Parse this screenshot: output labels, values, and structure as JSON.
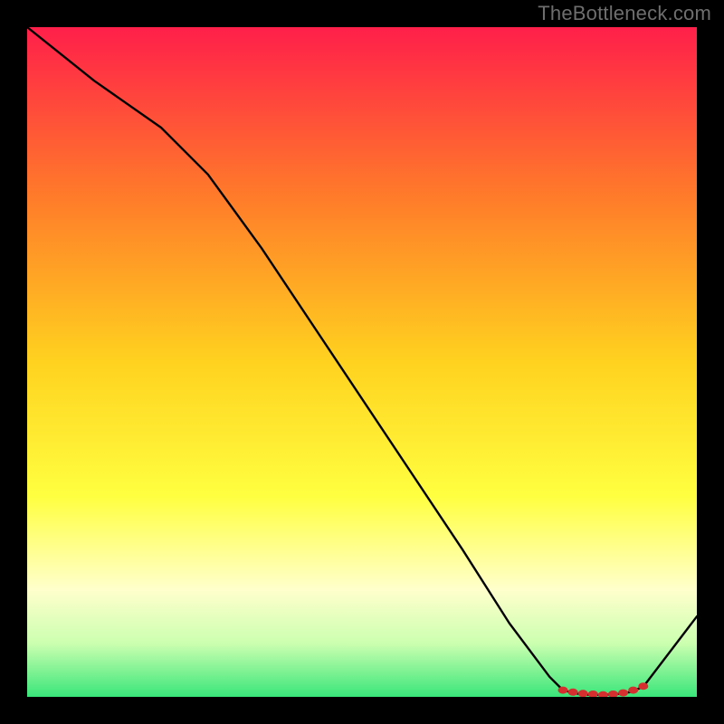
{
  "watermark": "TheBottleneck.com",
  "colors": {
    "curve": "#000000",
    "marker": "#d62f2f",
    "gradient_stops": [
      {
        "offset": "0%",
        "color": "#ff1f4a"
      },
      {
        "offset": "25%",
        "color": "#ff7a2a"
      },
      {
        "offset": "50%",
        "color": "#ffd21f"
      },
      {
        "offset": "70%",
        "color": "#ffff40"
      },
      {
        "offset": "84%",
        "color": "#ffffcc"
      },
      {
        "offset": "92%",
        "color": "#ccffb0"
      },
      {
        "offset": "100%",
        "color": "#39e67a"
      }
    ]
  },
  "chart_data": {
    "type": "line",
    "title": "",
    "xlabel": "",
    "ylabel": "",
    "xlim": [
      0,
      100
    ],
    "ylim": [
      0,
      100
    ],
    "x": [
      0,
      10,
      20,
      27,
      35,
      45,
      55,
      65,
      72,
      78,
      80,
      82,
      84,
      86,
      88,
      90,
      92,
      100
    ],
    "y": [
      100,
      92,
      85,
      78,
      67,
      52,
      37,
      22,
      11,
      3,
      1,
      0.5,
      0.3,
      0.3,
      0.4,
      0.7,
      1.5,
      12
    ],
    "markers": {
      "x": [
        80,
        81.5,
        83,
        84.5,
        86,
        87.5,
        89,
        90.5,
        92
      ],
      "y": [
        1.0,
        0.7,
        0.5,
        0.4,
        0.3,
        0.4,
        0.6,
        1.0,
        1.6
      ]
    }
  }
}
